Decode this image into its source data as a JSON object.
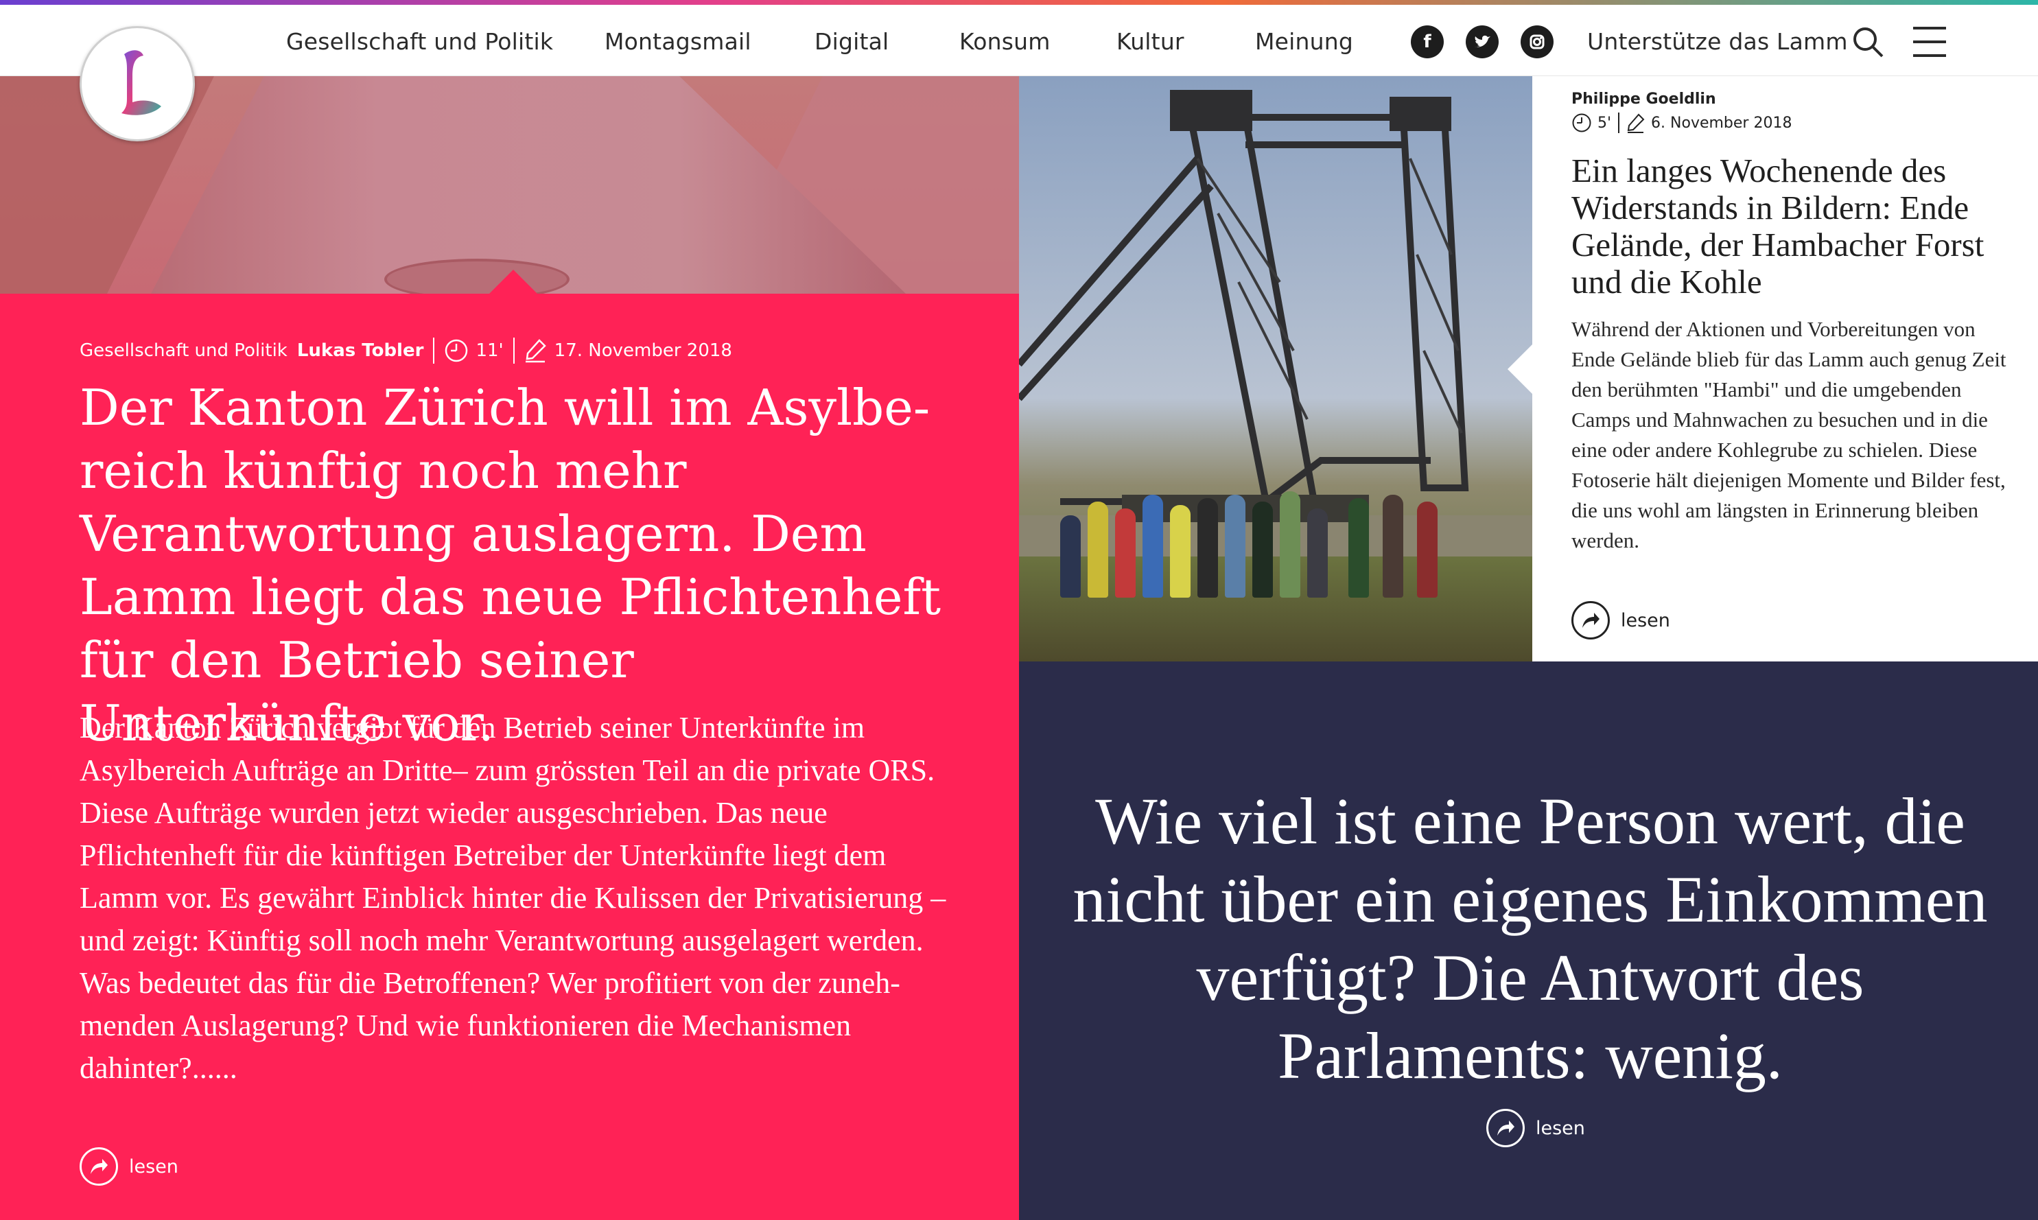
{
  "header": {
    "nav_items": [
      "Gesellschaft und Politik",
      "Montagsmail",
      "Digital",
      "Konsum",
      "Kultur",
      "Meinung"
    ],
    "support_label": "Unterstütze das Lamm",
    "social": [
      "facebook-icon",
      "twitter-icon",
      "instagram-icon"
    ],
    "logo_letter": "L"
  },
  "main_article": {
    "category": "Gesellschaft und Politik",
    "author": "Lukas Tobler",
    "read_time": "11'",
    "date": "17. November 2018",
    "headline": "Der Kanton Zürich will im Asylbe­reich künftig noch mehr Verantwor­tung auslagern. Dem Lamm liegt das neue Pflichtenheft für den Betrieb seiner Unterkünfte vor.",
    "teaser": "Der Kanton Zürich vergibt für den Betrieb seiner Unterkünfte im Asylbereich Aufträge an Dritte– zum grössten Teil an die private ORS. Diese Aufträge wurden jetzt wieder ausge­schrieben. Das neue Pflichtenheft für die künftigen Betreiber der Unterkünfte liegt dem Lamm vor. Es gewährt Einblick hinter die Kulissen der Privatisierung – und zeigt: Künftig soll noch mehr Verantwortung ausgelagert werden. Was be­deutet das für die Betroffenen? Wer profitiert von der zuneh­menden Auslagerung? Und wie funktionieren die Mechanis­men dahinter?......",
    "read_label": "lesen"
  },
  "photo_article": {
    "author": "Philippe Goeldlin",
    "read_time": "5'",
    "date": "6. November 2018",
    "title": "Ein langes Wochenende des Widerstands in Bildern: Ende Gelände, der Hambacher Forst und die Kohle",
    "teaser": "Während der Aktionen und Vorbereitun­gen von Ende Gelände blieb für das Lamm auch genug Zeit den berühmten \"Hambi\" und die umgebenden Camps und Mahnwa­chen zu besuchen und in die eine oder an­dere Kohlegrube zu schielen. Diese Fotose­rie hält diejenigen Momente und Bilder fest, die uns wohl am längsten in Erinne­rung bleiben werden.",
    "read_label": "lesen"
  },
  "quote_article": {
    "quote": "Wie viel ist eine Person wert, die nicht über ein eigenes Ein­kommen verfügt? Die Ant­wort des Parlaments: wenig.",
    "read_label": "lesen"
  },
  "colors": {
    "accent_red": "#ff2256",
    "dark_panel": "#2b2c4a"
  }
}
